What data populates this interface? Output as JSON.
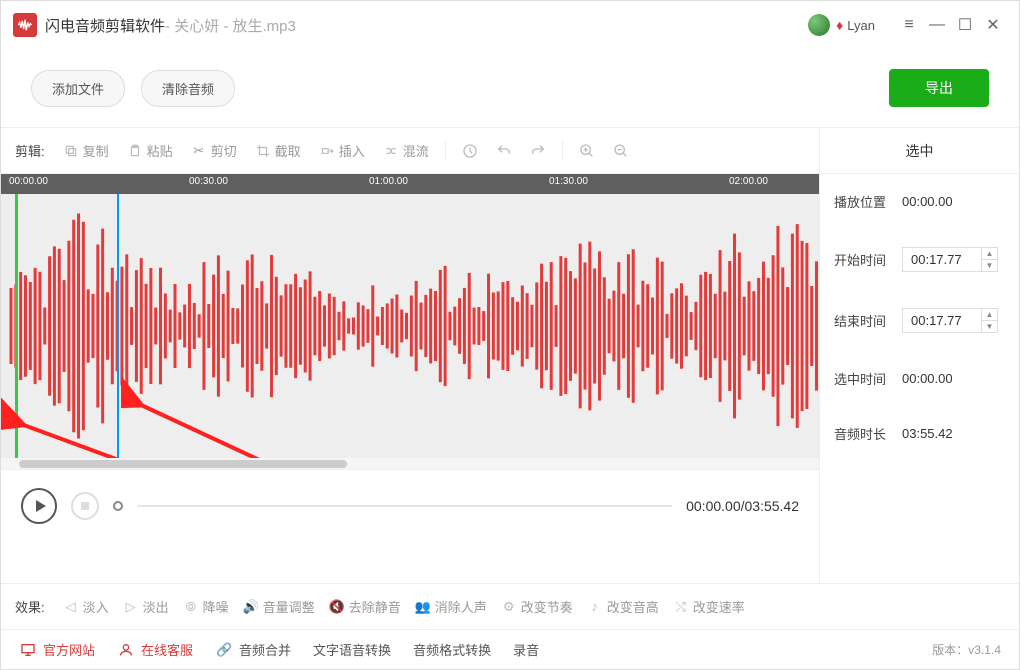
{
  "title_bar": {
    "app_name": "闪电音频剪辑软件",
    "separator": " - ",
    "file_name": "关心妍 - 放生.mp3",
    "username": "Lyan"
  },
  "top_buttons": {
    "add_file": "添加文件",
    "clear_audio": "清除音频",
    "export": "导出"
  },
  "toolbar": {
    "label": "剪辑:",
    "copy": "复制",
    "paste": "粘贴",
    "cut": "剪切",
    "crop": "截取",
    "insert": "插入",
    "mix": "混流"
  },
  "ruler": {
    "t0": "00:00.00",
    "t1": "00:30.00",
    "t2": "01:00.00",
    "t3": "01:30.00",
    "t4": "02:00.00"
  },
  "playback": {
    "time": "00:00.00/03:55.42"
  },
  "right_panel": {
    "header": "选中",
    "play_position_label": "播放位置",
    "play_position_value": "00:00.00",
    "start_time_label": "开始时间",
    "start_time_value": "00:17.77",
    "end_time_label": "结束时间",
    "end_time_value": "00:17.77",
    "selected_time_label": "选中时间",
    "selected_time_value": "00:00.00",
    "audio_duration_label": "音频时长",
    "audio_duration_value": "03:55.42"
  },
  "effects": {
    "label": "效果:",
    "fade_in": "淡入",
    "fade_out": "淡出",
    "denoise": "降噪",
    "volume": "音量调整",
    "remove_silence": "去除静音",
    "remove_vocals": "消除人声",
    "tempo": "改变节奏",
    "pitch": "改变音高",
    "speed": "改变速率"
  },
  "bottom": {
    "official_site": "官方网站",
    "online_support": "在线客服",
    "audio_merge": "音频合并",
    "tts": "文字语音转换",
    "format_convert": "音频格式转换",
    "record": "录音",
    "version_label": "版本：",
    "version": "v3.1.4"
  }
}
